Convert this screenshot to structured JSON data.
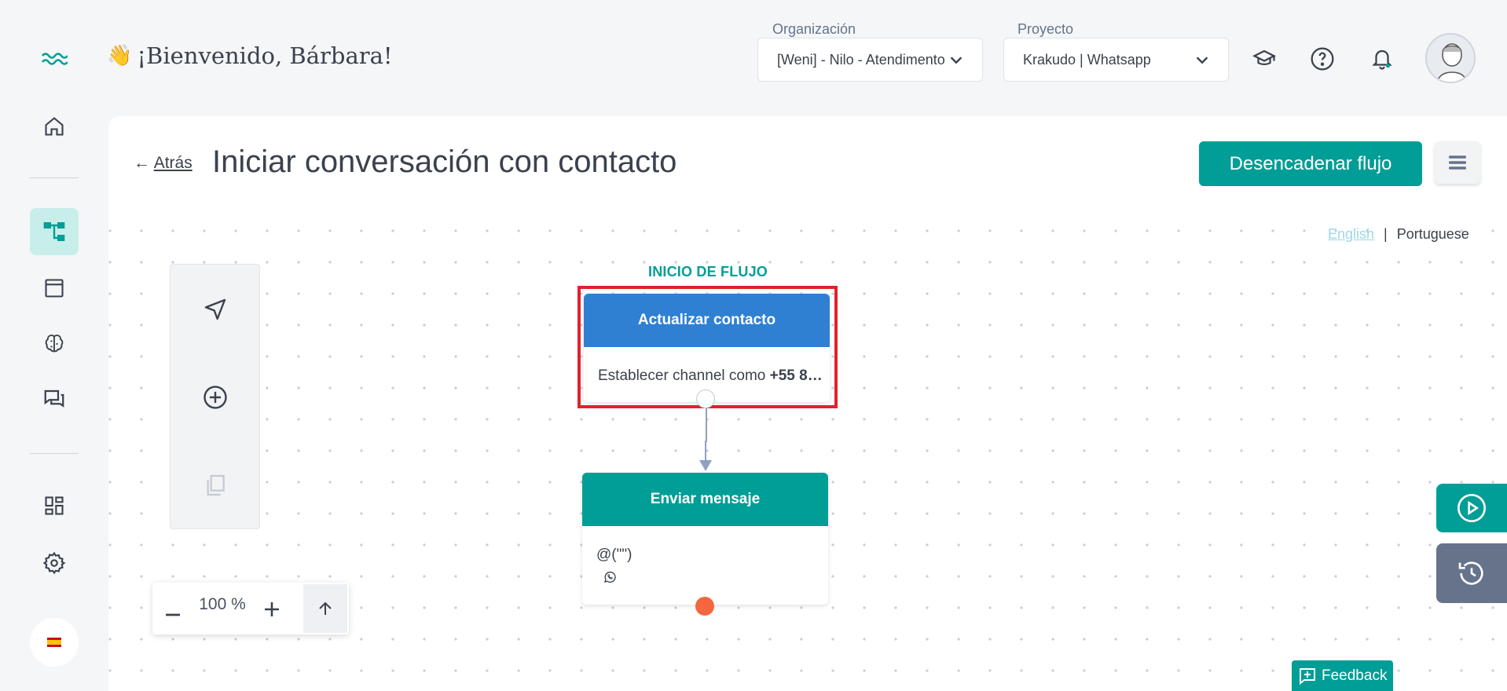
{
  "header": {
    "welcome_emoji": "👋",
    "welcome_text": "¡Bienvenido, Bárbara!",
    "organization_label": "Organización",
    "organization_value": "[Weni] - Nilo - Atendimento",
    "project_label": "Proyecto",
    "project_value": "Krakudo | Whatsapp",
    "icons": [
      "graduation-cap-icon",
      "help-icon",
      "bell-icon"
    ]
  },
  "sidebar": {
    "items": [
      "home-icon",
      "flows-icon",
      "browser-icon",
      "brain-icon",
      "chat-icon",
      "dashboard-icon",
      "settings-icon"
    ],
    "active_item": "flows-icon",
    "language_flag": "es"
  },
  "page": {
    "back_arrow": "←",
    "back_label": "Atrás",
    "title": "Iniciar conversación con contacto",
    "primary_button": "Desencadenar flujo"
  },
  "language_switch": {
    "english": "English",
    "separator": "|",
    "portuguese": "Portuguese"
  },
  "tools": [
    "send-icon",
    "add-circle-icon",
    "copy-icon"
  ],
  "zoom": {
    "value": "100 %"
  },
  "flow": {
    "start_label": "INICIO DE FLUJO",
    "node1": {
      "title": "Actualizar contacto",
      "body_prefix": "Establecer channel como ",
      "body_value": "+55 8…"
    },
    "node2": {
      "title": "Enviar mensaje",
      "body": "@(\"\")"
    }
  },
  "feedback_label": "Feedback",
  "colors": {
    "primary": "#009e96",
    "node_action_blue": "#2f80d3",
    "highlight_red": "#e3202d",
    "exit_red": "#f4663e",
    "history_tab": "#67738b"
  }
}
